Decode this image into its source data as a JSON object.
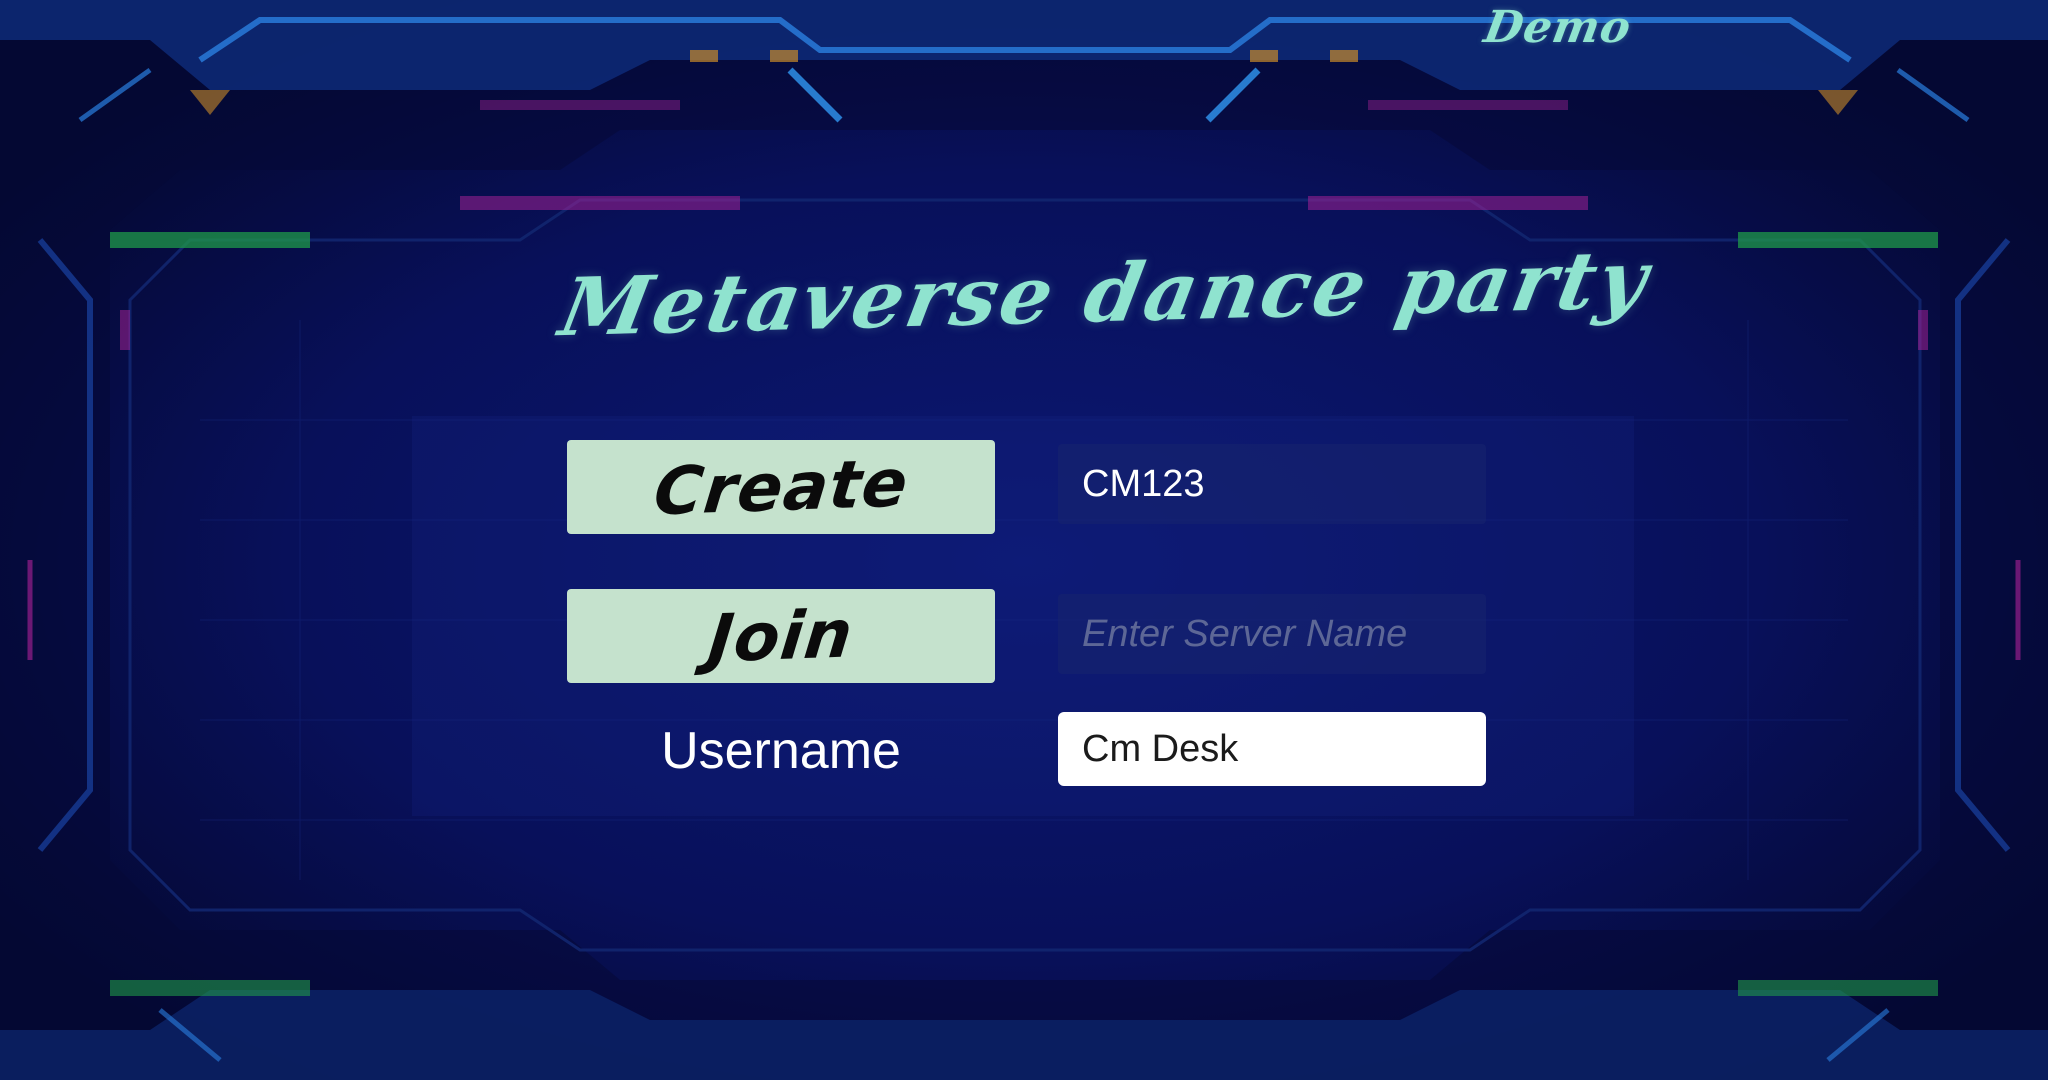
{
  "header": {
    "demo_label": "Demo"
  },
  "title": "Metaverse dance party",
  "menu": {
    "create_label": "Create",
    "join_label": "Join",
    "room_code_value": "CM123",
    "server_name_value": "",
    "server_name_placeholder": "Enter Server Name",
    "username_label": "Username",
    "username_value": "Cm Desk"
  },
  "colors": {
    "background": "#070b3d",
    "title_accent": "#8fe3cf",
    "button_fill": "#c5e2cd",
    "button_text": "#0b0b0b",
    "neon_blue": "#1e78d8",
    "neon_green": "#1f9a4a",
    "neon_magenta": "#b0229a"
  }
}
